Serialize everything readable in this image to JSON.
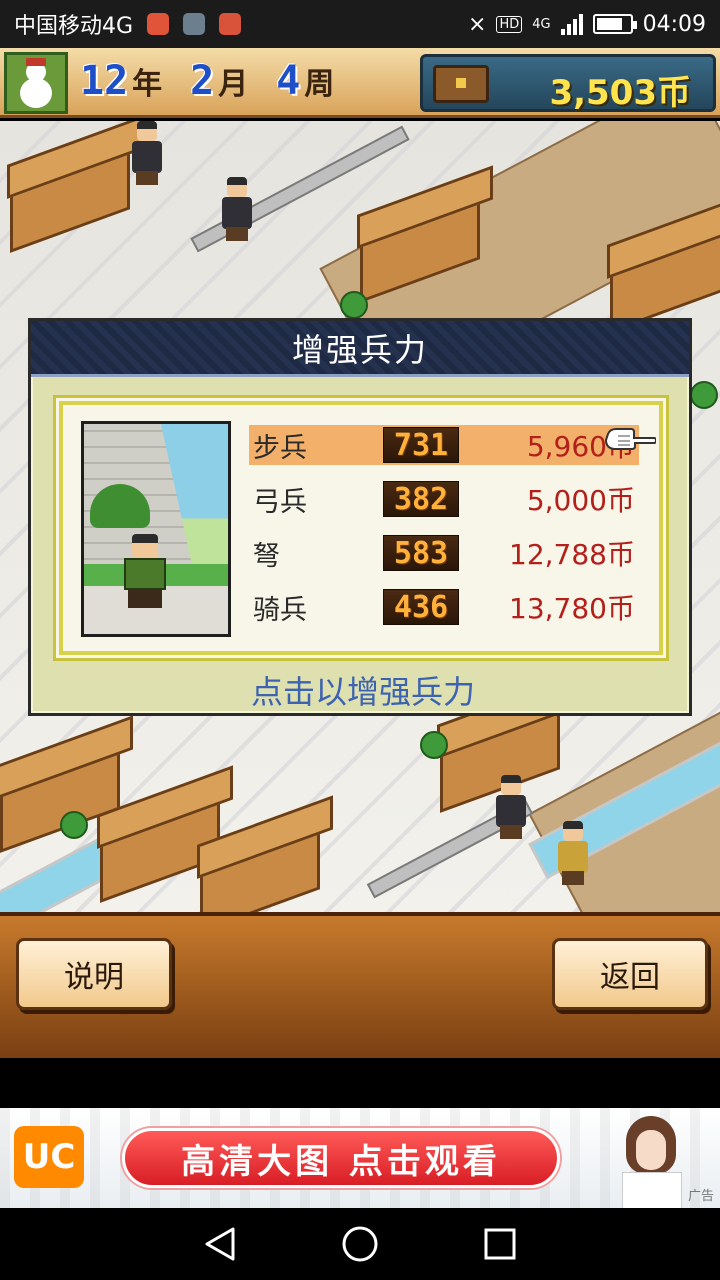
{
  "status_bar": {
    "carrier": "中国移动4G",
    "network_badge": "HD",
    "network_type": "4G",
    "time": "04:09",
    "battery_level": 0.8
  },
  "game_header": {
    "year": "12",
    "year_unit": "年",
    "month": "2",
    "month_unit": "月",
    "week": "4",
    "week_unit": "周",
    "money": "3,503币",
    "avatar_icon": "snowman-icon",
    "chest_icon": "treasure-chest-icon"
  },
  "dialog": {
    "title": "增强兵力",
    "hint": "点击以增强兵力",
    "troops": [
      {
        "name": "步兵",
        "count": "731",
        "price": "5,960币",
        "selected": true
      },
      {
        "name": "弓兵",
        "count": "382",
        "price": "5,000币",
        "selected": false
      },
      {
        "name": "弩",
        "count": "583",
        "price": "12,788币",
        "selected": false
      },
      {
        "name": "骑兵",
        "count": "436",
        "price": "13,780币",
        "selected": false
      }
    ],
    "pointer_icon": "pointing-hand-icon"
  },
  "buttons": {
    "help": "说明",
    "back": "返回"
  },
  "ad": {
    "logo_text": "UC",
    "cta": "高清大图 点击观看",
    "tag": "广告"
  },
  "colors": {
    "dialog_header": "#1e2a44",
    "selected_row": "#f2b06a",
    "price": "#b3201c",
    "hint": "#3c63b0",
    "money": "#ffe44d",
    "date_number": "#1e4fc8"
  }
}
